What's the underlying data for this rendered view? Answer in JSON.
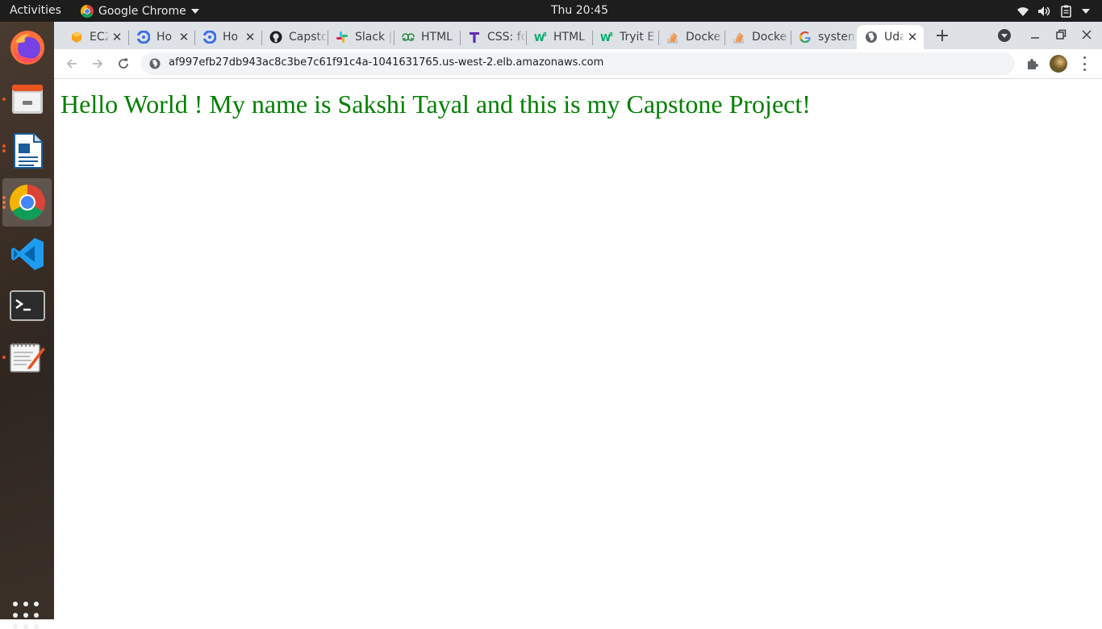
{
  "topbar": {
    "activities_label": "Activities",
    "app_name": "Google Chrome",
    "clock": "Thu 20:45",
    "tray_icons": [
      "wifi-icon",
      "volume-icon",
      "clipboard-icon",
      "system-menu-caret-icon"
    ]
  },
  "dock": {
    "items": [
      {
        "name": "firefox",
        "icon": "firefox-icon",
        "running": false
      },
      {
        "name": "files",
        "icon": "files-icon",
        "running": true
      },
      {
        "name": "libreoffice-writer",
        "icon": "writer-icon",
        "running": true
      },
      {
        "name": "google-chrome",
        "icon": "chrome-icon",
        "running": true,
        "active": true
      },
      {
        "name": "vscode",
        "icon": "vscode-icon",
        "running": false
      },
      {
        "name": "terminal",
        "icon": "terminal-icon",
        "running": false
      },
      {
        "name": "text-editor",
        "icon": "text-editor-icon",
        "running": true
      }
    ],
    "show_apps_icon": "app-grid-icon"
  },
  "tabs": [
    {
      "title": "EC2",
      "icon": "aws-icon"
    },
    {
      "title": "Ho",
      "icon": "circleci-icon"
    },
    {
      "title": "Ho",
      "icon": "circleci-icon"
    },
    {
      "title": "Capstc",
      "icon": "github-icon"
    },
    {
      "title": "Slack |",
      "icon": "slack-icon"
    },
    {
      "title": "HTML",
      "icon": "geeksforgeeks-icon"
    },
    {
      "title": "CSS: fc",
      "icon": "t-icon"
    },
    {
      "title": "HTML",
      "icon": "w3schools-icon"
    },
    {
      "title": "Tryit E",
      "icon": "w3schools-icon"
    },
    {
      "title": "Docke",
      "icon": "stackoverflow-icon"
    },
    {
      "title": "Docke",
      "icon": "stackoverflow-icon"
    },
    {
      "title": "systen",
      "icon": "google-icon"
    },
    {
      "title": "Uda",
      "icon": "globe-icon",
      "active": true
    }
  ],
  "toolbar": {
    "url": "af997efb27db943ac8c3be7c61f91c4a-1041631765.us-west-2.elb.amazonaws.com"
  },
  "page": {
    "greeting": "Hello World ! My name is Sakshi Tayal and this is my Capstone Project!"
  },
  "colors": {
    "greeting_text": "#008000",
    "ubuntu_accent": "#e95420",
    "tabstrip_bg": "#dee1e6",
    "topbar_bg": "#1d1d1d"
  }
}
